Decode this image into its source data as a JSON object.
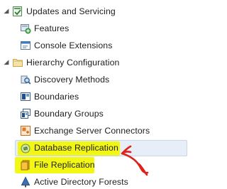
{
  "tree": {
    "updates_and_servicing": {
      "label": "Updates and Servicing",
      "expander": "◢",
      "children": {
        "features": "Features",
        "console_extensions": "Console Extensions"
      }
    },
    "hierarchy_configuration": {
      "label": "Hierarchy Configuration",
      "expander": "◢",
      "children": {
        "discovery_methods": "Discovery Methods",
        "boundaries": "Boundaries",
        "boundary_groups": "Boundary Groups",
        "exchange_server_connectors": "Exchange Server Connectors",
        "database_replication": "Database Replication",
        "file_replication": "File Replication",
        "active_directory_forests": "Active Directory Forests"
      }
    }
  },
  "colors": {
    "highlight": "#f2f600",
    "annotation_arrow": "#e0201c",
    "selection": "#e8eef8"
  }
}
